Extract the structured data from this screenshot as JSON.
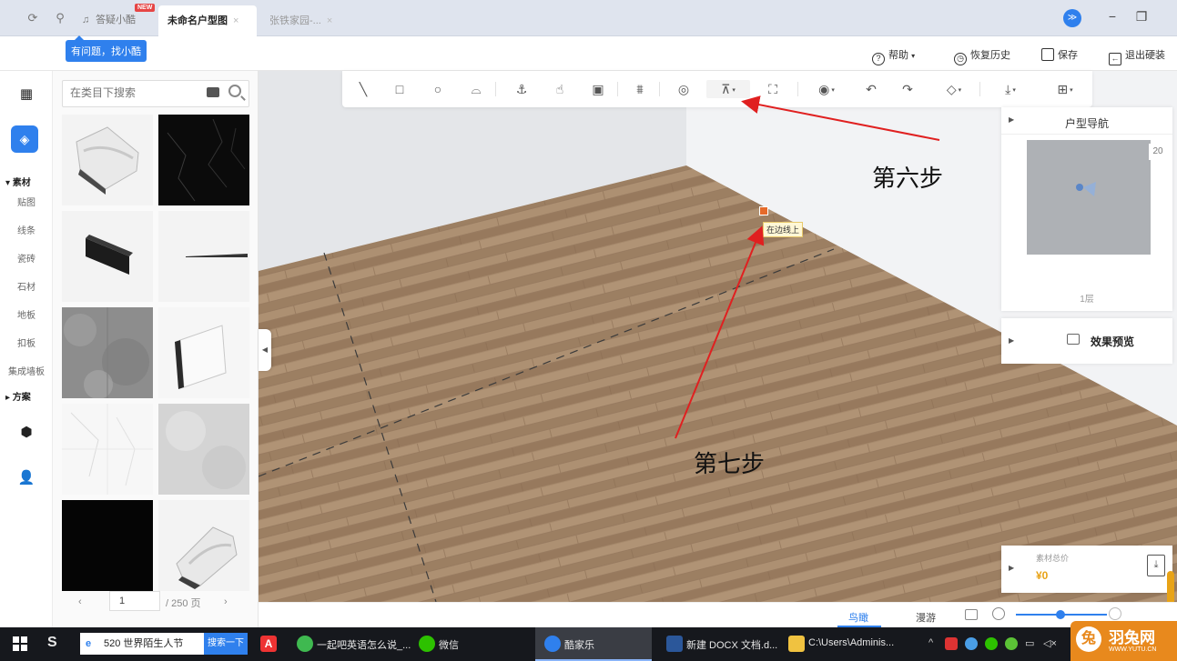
{
  "titlebar": {
    "qa_label": "答疑小酷",
    "new_badge": "NEW",
    "tabs": [
      {
        "label": "未命名户型图",
        "close": "×"
      },
      {
        "label": "张铁家园-...",
        "close": "×"
      }
    ]
  },
  "help_tag": "有问题，找小酷",
  "actions": {
    "help": "帮助",
    "restore": "恢复历史",
    "save": "保存",
    "exit": "退出硬装"
  },
  "rail": {
    "section_material": "▾ 素材",
    "items": [
      "贴图",
      "线条",
      "瓷砖",
      "石材",
      "地板",
      "扣板",
      "集成墙板"
    ],
    "section_plan": "▸ 方案"
  },
  "panel": {
    "search_placeholder": "在类目下搜索",
    "page_current": "1",
    "page_total": "/ 250 页",
    "prev": "‹",
    "next": "›"
  },
  "navigator": {
    "title": "户型导航",
    "zoom": "20",
    "floor": "1层"
  },
  "preview": {
    "label": "效果预览"
  },
  "price": {
    "label": "素材总价",
    "value": "¥0"
  },
  "viewbar": {
    "tab_bird": "鸟瞰",
    "tab_walk": "漫游"
  },
  "annotations": {
    "step6": "第六步",
    "step7": "第七步",
    "snap_tooltip": "在边线上"
  },
  "taskbar": {
    "search_text": "520 世界陌生人节",
    "search_button": "搜索一下",
    "apps": [
      {
        "label": "一起吧英语怎么说_...",
        "icon": "browser-icon"
      },
      {
        "label": "微信",
        "icon": "wechat-icon"
      },
      {
        "label": "酷家乐",
        "icon": "kujiale-icon"
      },
      {
        "label": "新建 DOCX 文档.d...",
        "icon": "word-icon"
      },
      {
        "label": "C:\\Users\\Adminis...",
        "icon": "folder-icon"
      }
    ],
    "tray_text": "^"
  },
  "watermark": {
    "name": "羽兔网",
    "url": "WWW.YUTU.CN"
  },
  "colors": {
    "accent": "#2f80ed",
    "price": "#e8a317",
    "arrow": "#e02020",
    "brand_orange": "#e8891d"
  }
}
